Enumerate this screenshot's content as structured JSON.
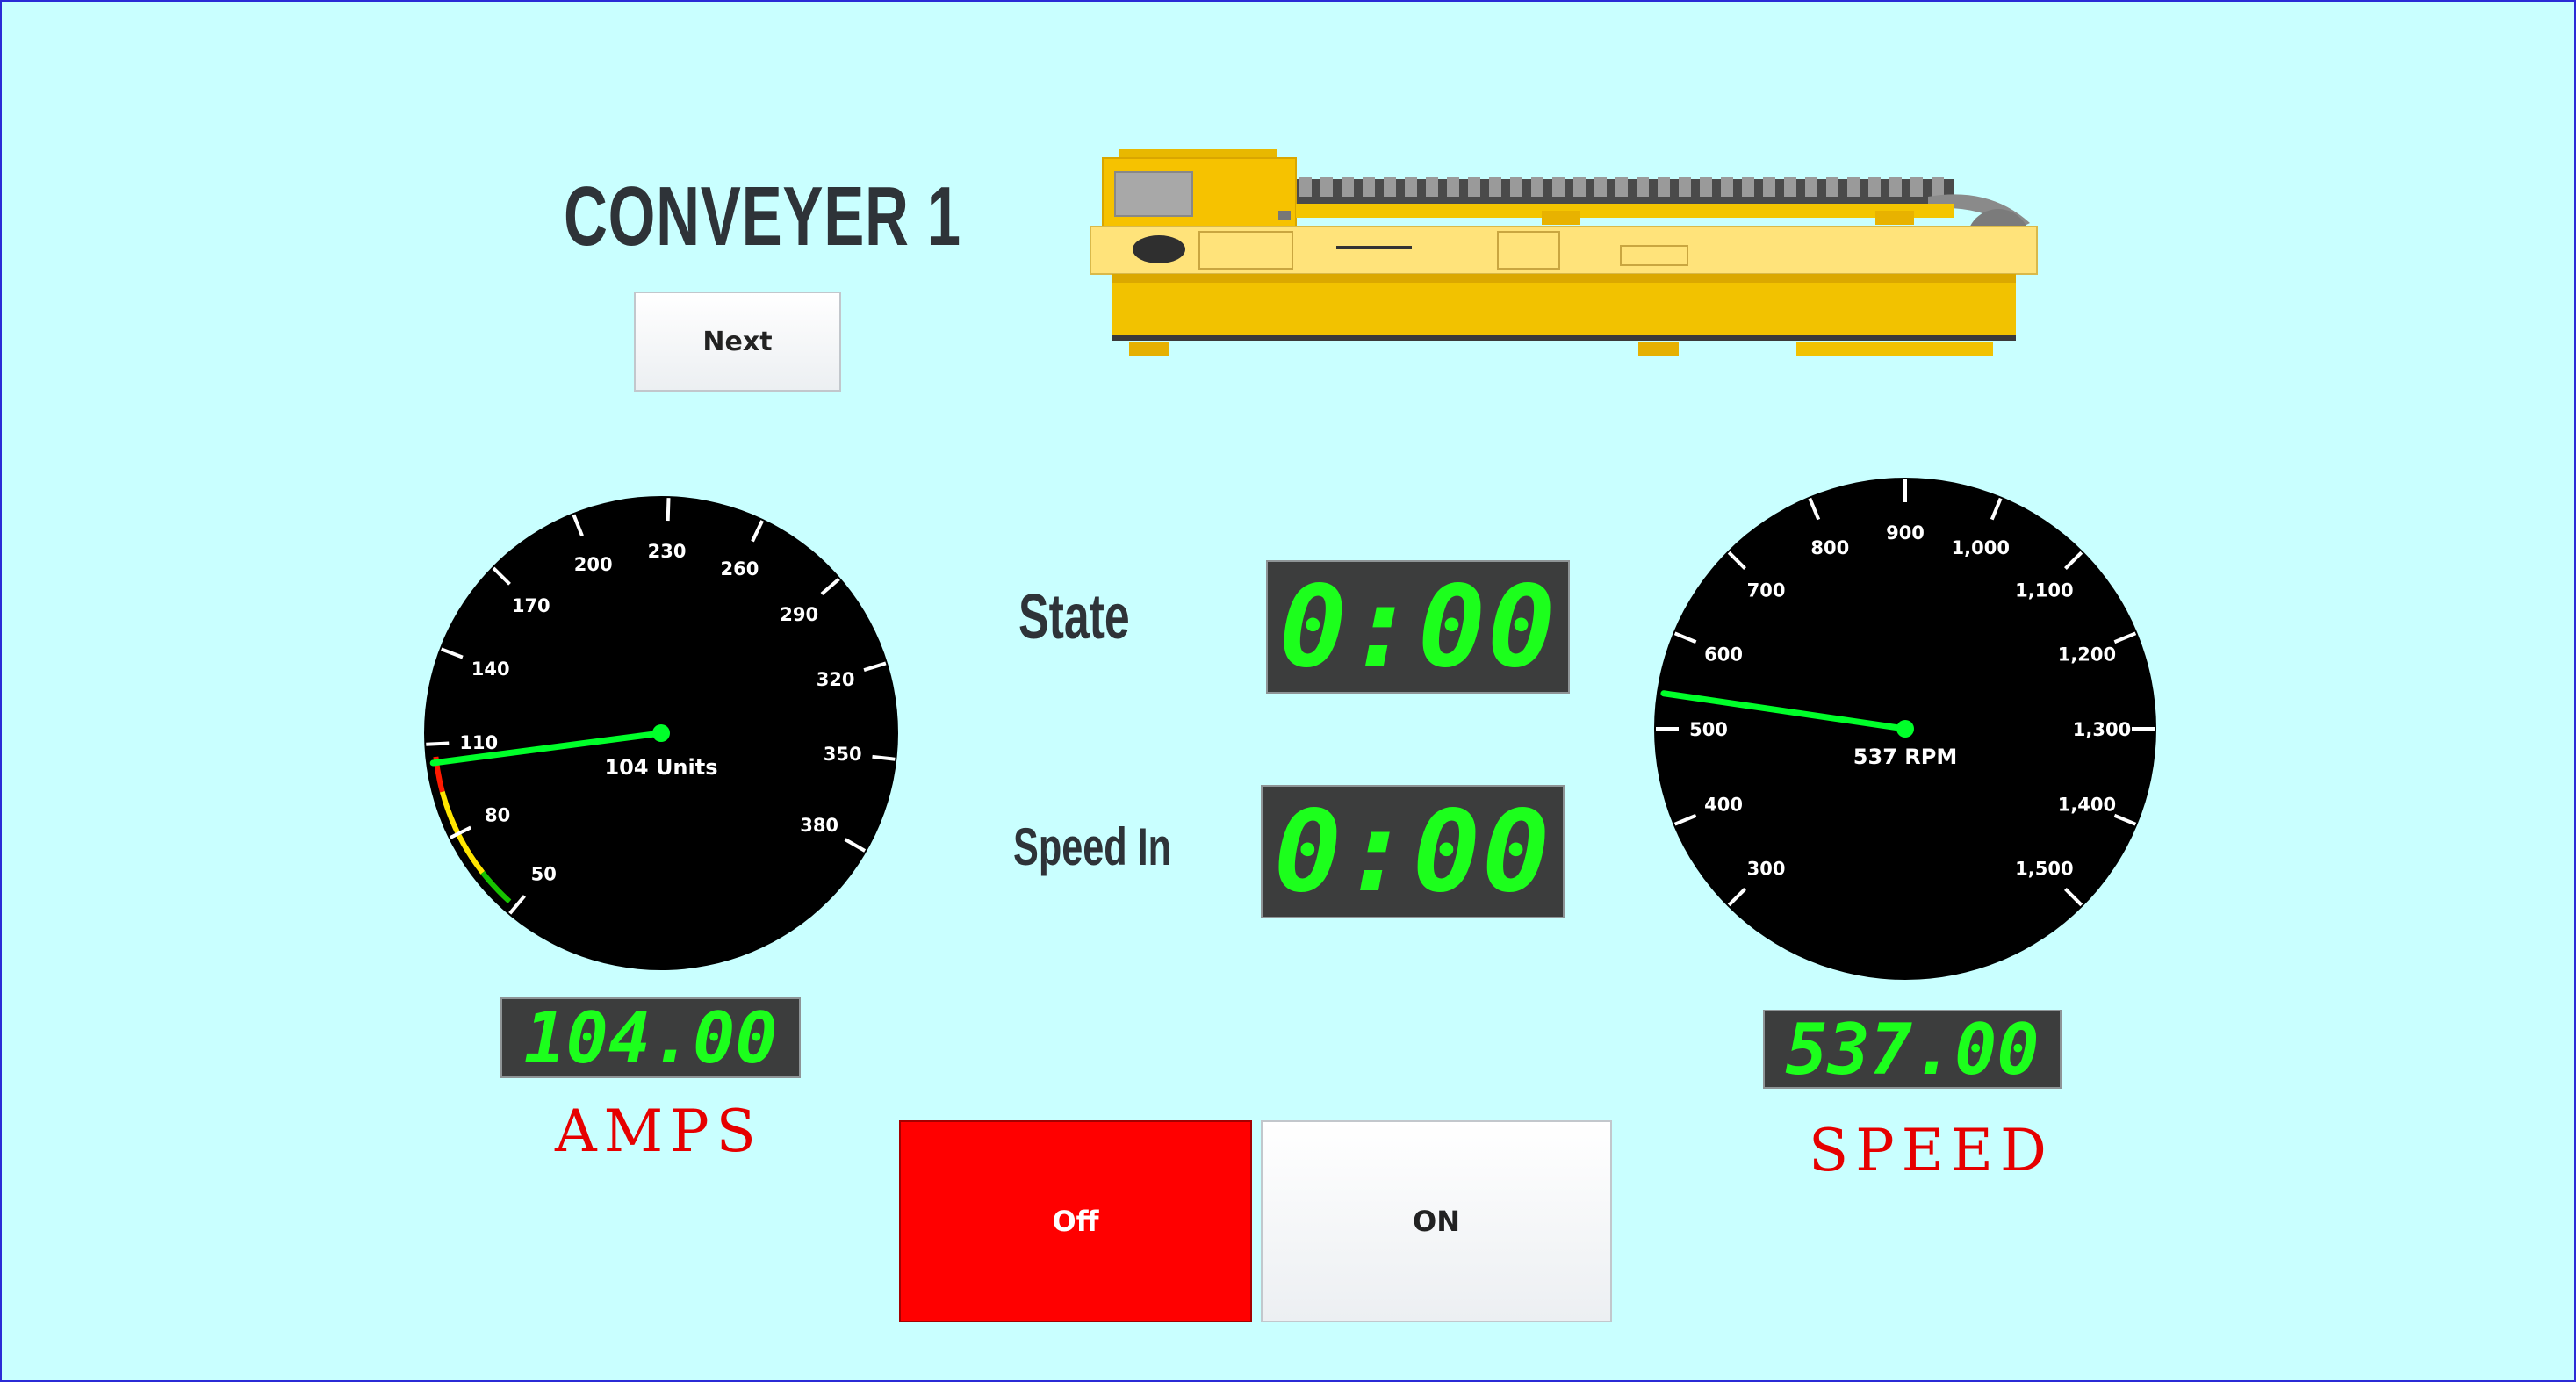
{
  "title": "CONVEYER 1",
  "buttons": {
    "next": "Next",
    "off": "Off",
    "on": "ON"
  },
  "labels": {
    "state": "State",
    "speed_in": "Speed In",
    "amps": "AMPS",
    "speed": "SPEED"
  },
  "displays": {
    "state": "0:00",
    "speed_in": "0:00",
    "amps": "104.00",
    "speed": "537.00"
  },
  "amps_gauge": {
    "readout": "104 Units",
    "value": 104,
    "min": 50,
    "max": 380,
    "ticks": [
      "50",
      "80",
      "110",
      "140",
      "170",
      "200",
      "230",
      "260",
      "290",
      "320",
      "350",
      "380"
    ]
  },
  "speed_gauge": {
    "readout": "537 RPM",
    "value": 537,
    "min": 300,
    "max": 1500,
    "ticks": [
      "300",
      "400",
      "500",
      "600",
      "700",
      "800",
      "900",
      "1,000",
      "1,100",
      "1,200",
      "1,300",
      "1,400",
      "1,500"
    ]
  },
  "colors": {
    "background": "#c9ffff",
    "needle": "#00ff2a",
    "off_button": "#ff0000",
    "lcd_text": "#1cff1c",
    "label_red": "#e60000"
  }
}
